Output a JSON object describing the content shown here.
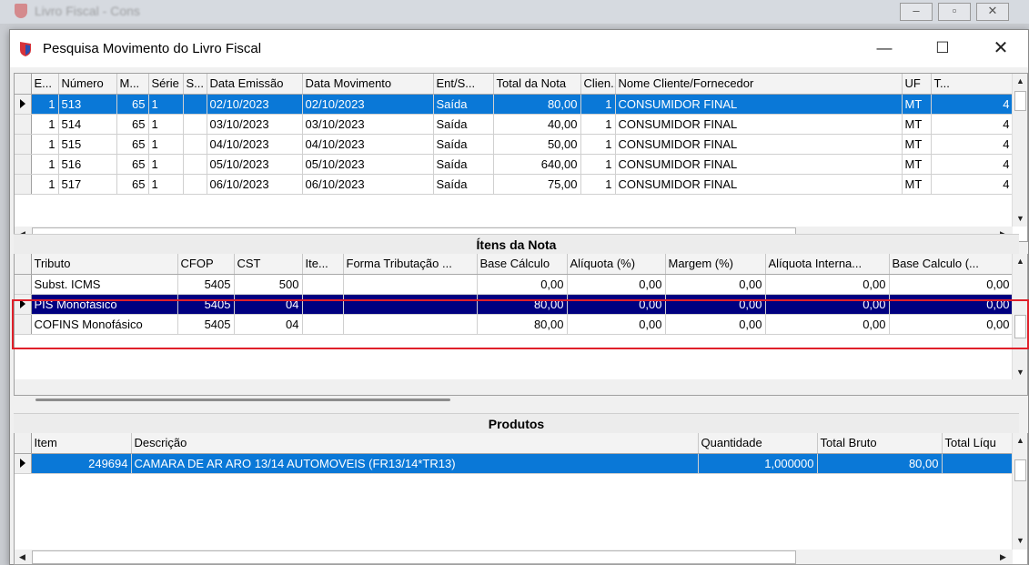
{
  "background_window": {
    "title": "Livro Fiscal - Cons"
  },
  "dialog": {
    "title": "Pesquisa Movimento do Livro Fiscal",
    "minimize_label": "—",
    "maximize_label": "☐",
    "close_label": "✕"
  },
  "movimento": {
    "columns": [
      "E...",
      "Número",
      "M...",
      "Série",
      "S...",
      "Data Emissão",
      "Data Movimento",
      "Ent/S...",
      "Total da Nota",
      "Clien...",
      "Nome Cliente/Fornecedor",
      "UF",
      "T..."
    ],
    "rows": [
      [
        "1",
        "513",
        "65",
        "1",
        "",
        "02/10/2023",
        "02/10/2023",
        "Saída",
        "80,00",
        "1",
        "CONSUMIDOR FINAL",
        "MT",
        "4"
      ],
      [
        "1",
        "514",
        "65",
        "1",
        "",
        "03/10/2023",
        "03/10/2023",
        "Saída",
        "40,00",
        "1",
        "CONSUMIDOR FINAL",
        "MT",
        "4"
      ],
      [
        "1",
        "515",
        "65",
        "1",
        "",
        "04/10/2023",
        "04/10/2023",
        "Saída",
        "50,00",
        "1",
        "CONSUMIDOR FINAL",
        "MT",
        "4"
      ],
      [
        "1",
        "516",
        "65",
        "1",
        "",
        "05/10/2023",
        "05/10/2023",
        "Saída",
        "640,00",
        "1",
        "CONSUMIDOR FINAL",
        "MT",
        "4"
      ],
      [
        "1",
        "517",
        "65",
        "1",
        "",
        "06/10/2023",
        "06/10/2023",
        "Saída",
        "75,00",
        "1",
        "CONSUMIDOR FINAL",
        "MT",
        "4"
      ]
    ]
  },
  "itens": {
    "title": "Ítens da Nota",
    "columns": [
      "Tributo",
      "CFOP",
      "CST",
      "Ite...",
      "Forma Tributação ...",
      "Base Cálculo",
      "Alíquota (%)",
      "Margem (%)",
      "Alíquota Interna...",
      "Base Calculo (..."
    ],
    "rows": [
      [
        "Subst. ICMS",
        "5405",
        "500",
        "",
        "",
        "0,00",
        "0,00",
        "0,00",
        "0,00",
        "0,00"
      ],
      [
        "PIS Monofásico",
        "5405",
        "04",
        "",
        "",
        "80,00",
        "0,00",
        "0,00",
        "0,00",
        "0,00"
      ],
      [
        "COFINS Monofásico",
        "5405",
        "04",
        "",
        "",
        "80,00",
        "0,00",
        "0,00",
        "0,00",
        "0,00"
      ]
    ]
  },
  "produtos": {
    "title": "Produtos",
    "columns": [
      "Item",
      "Descrição",
      "Quantidade",
      "Total Bruto",
      "Total Líqu"
    ],
    "rows": [
      [
        "249694",
        "CAMARA DE AR ARO 13/14 AUTOMOVEIS (FR13/14*TR13)",
        "1,000000",
        "80,00",
        ""
      ]
    ]
  },
  "colors": {
    "selection_blue": "#0a78d7",
    "selection_navy": "#000080",
    "highlight_red": "#e0202a"
  }
}
